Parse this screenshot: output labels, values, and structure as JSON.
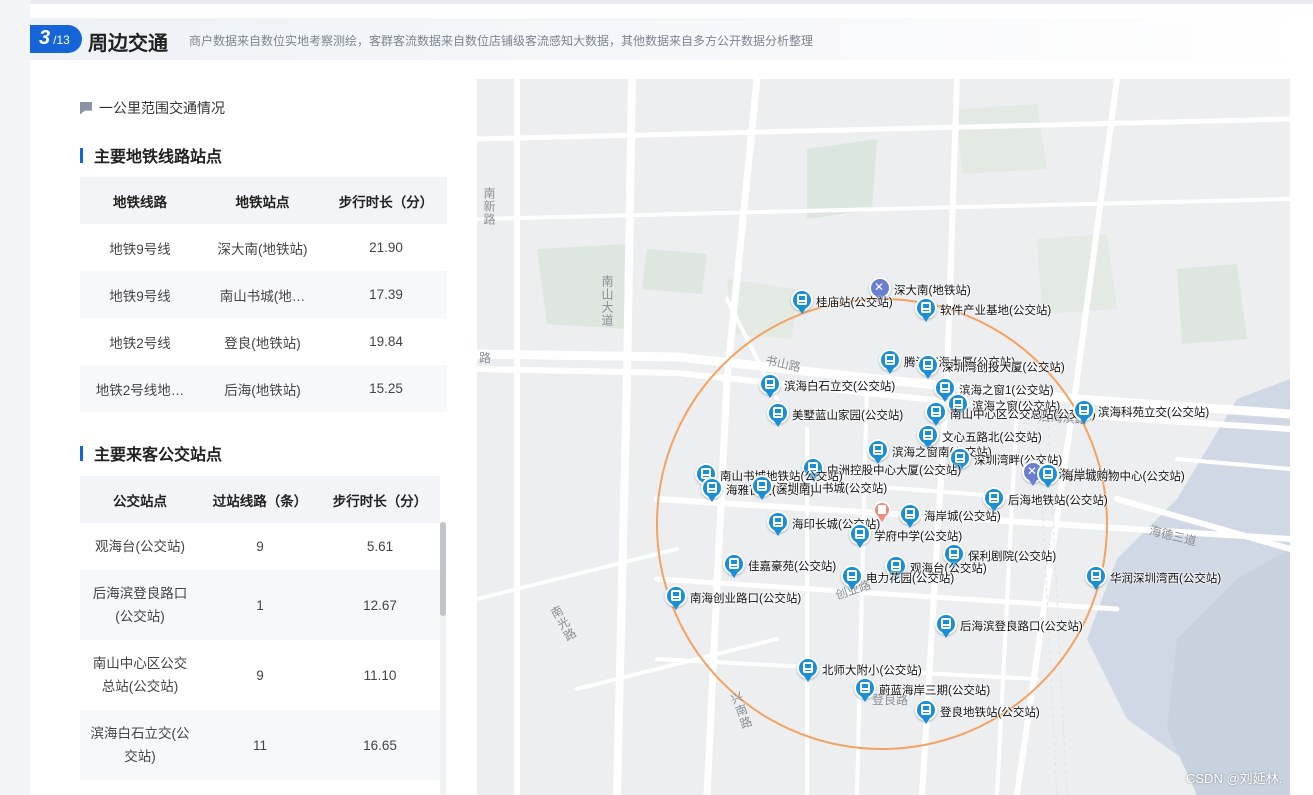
{
  "header": {
    "page_current": "3",
    "page_total": "/13",
    "title": "周边交通",
    "subtitle": "商户数据来自数位实地考察测绘，客群客流数据来自数位店铺级客流感知大数据，其他数据来自多方公开数据分析整理"
  },
  "left": {
    "note": "一公里范围交通情况",
    "metro_heading": "主要地铁线路站点",
    "metro_table": {
      "headers": [
        "地铁线路",
        "地铁站点",
        "步行时长（分）"
      ],
      "rows": [
        [
          "地铁9号线",
          "深大南(地铁站)",
          "21.90"
        ],
        [
          "地铁9号线",
          "南山书城(地…",
          "17.39"
        ],
        [
          "地铁2号线",
          "登良(地铁站)",
          "19.84"
        ],
        [
          "地铁2号线地…",
          "后海(地铁站)",
          "15.25"
        ]
      ]
    },
    "bus_heading": "主要来客公交站点",
    "bus_table": {
      "headers": [
        "公交站点",
        "过站线路（条）",
        "步行时长（分）"
      ],
      "rows": [
        [
          "观海台(公交站)",
          "9",
          "5.61"
        ],
        [
          "后海滨登良路口(公交站)",
          "1",
          "12.67"
        ],
        [
          "南山中心区公交总站(公交站)",
          "9",
          "11.10"
        ],
        [
          "滨海白石立交(公交站)",
          "11",
          "16.65"
        ]
      ]
    }
  },
  "map": {
    "road_labels": [
      "南新路",
      "南山大道",
      "路",
      "书山路",
      "创业路",
      "南光路",
      "兴南路",
      "登良路",
      "海德三道",
      "后海滨路"
    ],
    "stations": [
      {
        "label": "深大南(地铁站)",
        "kind": "metro"
      },
      {
        "label": "桂庙站(公交站)",
        "kind": "bus"
      },
      {
        "label": "软件产业基地(公交站)",
        "kind": "bus"
      },
      {
        "label": "腾讯滨海大厦(公交站)",
        "kind": "bus"
      },
      {
        "label": "深圳湾创投大厦(公交站)",
        "kind": "bus"
      },
      {
        "label": "滨海白石立交(公交站)",
        "kind": "bus"
      },
      {
        "label": "滨海之窗1(公交站)",
        "kind": "bus"
      },
      {
        "label": "滨海之窗(公交站)",
        "kind": "bus"
      },
      {
        "label": "南山中心区公交总站(公交站)",
        "kind": "bus"
      },
      {
        "label": "美墅蓝山家园(公交站)",
        "kind": "bus"
      },
      {
        "label": "滨海科苑立交(公交站)",
        "kind": "bus"
      },
      {
        "label": "文心五路北(公交站)",
        "kind": "bus"
      },
      {
        "label": "滨海之窗南(公交站)",
        "kind": "bus"
      },
      {
        "label": "深圳湾畔(公交站)",
        "kind": "bus"
      },
      {
        "label": "中洲控股中心大厦(公交站)",
        "kind": "bus"
      },
      {
        "label": "南山书城地铁站(公交站)",
        "kind": "bus"
      },
      {
        "label": "海雅百货(公交站)",
        "kind": "bus"
      },
      {
        "label": "深圳南山书城(公交站)",
        "kind": "bus"
      },
      {
        "label": "后海(地铁站)",
        "kind": "metro"
      },
      {
        "label": "海岸城购物中心(公交站)",
        "kind": "bus"
      },
      {
        "label": "后海地铁站(公交站)",
        "kind": "bus"
      },
      {
        "label": "海印长城(公交站)",
        "kind": "bus"
      },
      {
        "label": "海岸城(公交站)",
        "kind": "bus"
      },
      {
        "label": "学府中学(公交站)",
        "kind": "bus"
      },
      {
        "label": "保利剧院(公交站)",
        "kind": "bus"
      },
      {
        "label": "佳嘉豪苑(公交站)",
        "kind": "bus"
      },
      {
        "label": "观海台(公交站)",
        "kind": "bus"
      },
      {
        "label": "电力花园(公交站)",
        "kind": "bus"
      },
      {
        "label": "华润深圳湾西(公交站)",
        "kind": "bus"
      },
      {
        "label": "南海创业路口(公交站)",
        "kind": "bus"
      },
      {
        "label": "后海滨登良路口(公交站)",
        "kind": "bus"
      },
      {
        "label": "北师大附小(公交站)",
        "kind": "bus"
      },
      {
        "label": "蔚蓝海岸三期(公交站)",
        "kind": "bus"
      },
      {
        "label": "登良地铁站(公交站)",
        "kind": "bus"
      }
    ],
    "colors": {
      "radius_circle": "#f4a261",
      "bus_marker": "#1a8fd6",
      "metro_marker": "#6a7fd0",
      "center_marker": "#f08a7e"
    }
  },
  "watermark": "CSDN @刘延林."
}
